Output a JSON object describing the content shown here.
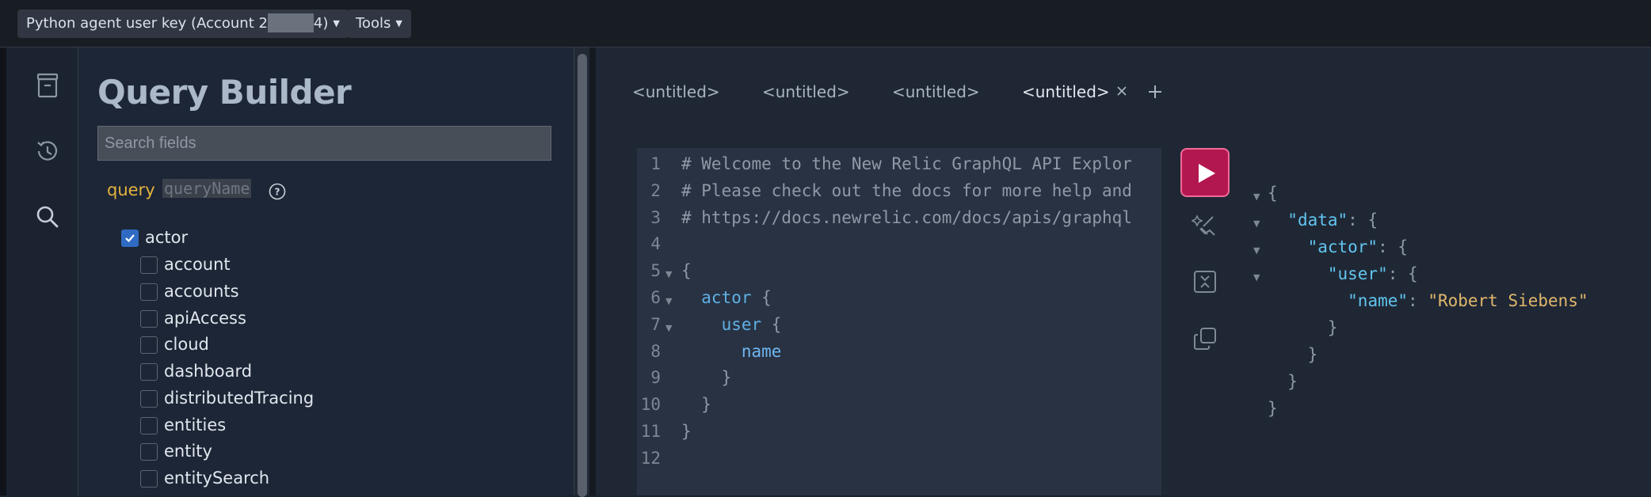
{
  "topbar": {
    "account_prefix": "Python agent user key (Account 2",
    "account_suffix": "4)",
    "tools_label": "Tools"
  },
  "sidebar_icons": [
    "archive-icon",
    "history-icon",
    "search-icon"
  ],
  "query_builder": {
    "title": "Query Builder",
    "search_placeholder": "Search fields",
    "query_keyword": "query",
    "query_name_placeholder": "queryName",
    "tree": {
      "root": {
        "label": "actor",
        "checked": true
      },
      "children": [
        {
          "label": "account",
          "checked": false
        },
        {
          "label": "accounts",
          "checked": false
        },
        {
          "label": "apiAccess",
          "checked": false
        },
        {
          "label": "cloud",
          "checked": false
        },
        {
          "label": "dashboard",
          "checked": false
        },
        {
          "label": "distributedTracing",
          "checked": false
        },
        {
          "label": "entities",
          "checked": false
        },
        {
          "label": "entity",
          "checked": false
        },
        {
          "label": "entitySearch",
          "checked": false
        }
      ]
    }
  },
  "tabs": [
    {
      "label": "<untitled>",
      "active": false
    },
    {
      "label": "<untitled>",
      "active": false
    },
    {
      "label": "<untitled>",
      "active": false
    },
    {
      "label": "<untitled>",
      "active": true
    }
  ],
  "tab_add_label": "+",
  "editor": {
    "lines": [
      {
        "n": "1",
        "text": "# Welcome to the New Relic GraphQL API Explor",
        "fold": false
      },
      {
        "n": "2",
        "text": "# Please check out the docs for more help and",
        "fold": false
      },
      {
        "n": "3",
        "text": "# https://docs.newrelic.com/docs/apis/graphql",
        "fold": false
      },
      {
        "n": "4",
        "text": "",
        "fold": false
      },
      {
        "n": "5",
        "text": "{",
        "fold": true
      },
      {
        "n": "6",
        "text": "  actor {",
        "fold": true
      },
      {
        "n": "7",
        "text": "    user {",
        "fold": true
      },
      {
        "n": "8",
        "text": "      name",
        "fold": false
      },
      {
        "n": "9",
        "text": "    }",
        "fold": false
      },
      {
        "n": "10",
        "text": "  }",
        "fold": false
      },
      {
        "n": "11",
        "text": "}",
        "fold": false
      },
      {
        "n": "12",
        "text": "",
        "fold": false
      }
    ]
  },
  "actions": [
    "run-button",
    "prettify-button",
    "collapse-button",
    "copy-button"
  ],
  "result": {
    "key_data": "\"data\"",
    "key_actor": "\"actor\"",
    "key_user": "\"user\"",
    "key_name": "\"name\"",
    "value_name": "\"Robert Siebens\""
  },
  "colors": {
    "run_button": "#b3174f",
    "checkbox_checked": "#2f6bc3",
    "query_keyword": "#e3b33e",
    "json_key": "#62c5ef",
    "json_string": "#e2b86b"
  }
}
